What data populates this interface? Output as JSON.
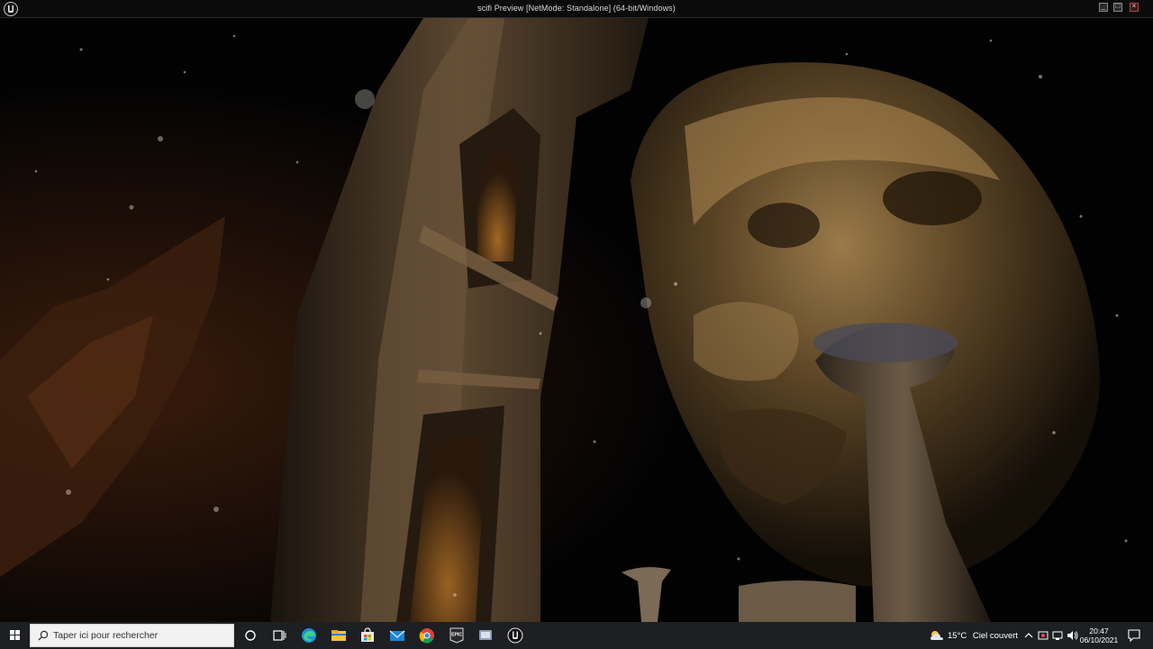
{
  "window": {
    "title": "scifi Preview [NetMode: Standalone]  (64-bit/Windows)",
    "buttons": {
      "minimize": "minimize-icon",
      "maximize": "maximize-icon",
      "close": "close-icon"
    }
  },
  "taskbar": {
    "search_placeholder": "Taper ici pour rechercher",
    "apps": [
      "cortana-icon",
      "task-view-icon",
      "edge-icon",
      "file-explorer-icon",
      "store-icon",
      "mail-icon",
      "chrome-icon",
      "epic-games-icon",
      "app-icon",
      "unreal-engine-icon"
    ],
    "weather": {
      "temperature": "15°C",
      "condition": "Ciel couvert"
    },
    "clock": {
      "time": "20:47",
      "date": "06/10/2021"
    }
  },
  "colors": {
    "taskbar_bg": "#1d1f22",
    "titlebar_bg": "#0b0b0b",
    "active_indicator": "#c86bb5",
    "gold": "#8a6a3a"
  }
}
